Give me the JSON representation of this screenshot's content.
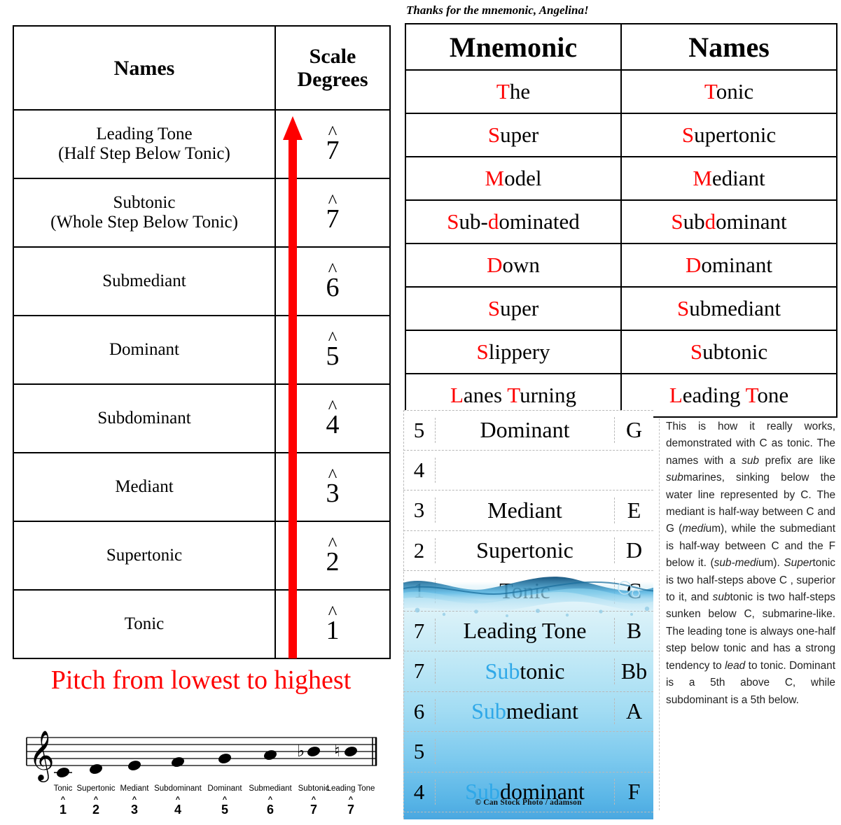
{
  "left_table": {
    "headers": {
      "names": "Names",
      "degrees": "Scale Degrees",
      "degrees_line1": "Scale",
      "degrees_line2": "Degrees"
    },
    "rows": [
      {
        "name": "Leading Tone",
        "qualifier": "(Half Step Below Tonic)",
        "degree": "7"
      },
      {
        "name": "Subtonic",
        "qualifier": "(Whole Step Below Tonic)",
        "degree": "7"
      },
      {
        "name": "Submediant",
        "qualifier": "",
        "degree": "6"
      },
      {
        "name": "Dominant",
        "qualifier": "",
        "degree": "5"
      },
      {
        "name": "Subdominant",
        "qualifier": "",
        "degree": "4"
      },
      {
        "name": "Mediant",
        "qualifier": "",
        "degree": "3"
      },
      {
        "name": "Supertonic",
        "qualifier": "",
        "degree": "2"
      },
      {
        "name": "Tonic",
        "qualifier": "",
        "degree": "1"
      }
    ],
    "arrow_color": "#fe0000",
    "caption": "Pitch from lowest to highest",
    "caption_color": "#fe0000"
  },
  "mnemonic": {
    "note": "Thanks for the mnemonic, Angelina!",
    "headers": {
      "mnemonic": "Mnemonic",
      "names": "Names"
    },
    "highlight_color": "#fe0000",
    "rows": [
      {
        "m_hl1": "T",
        "m_rest1": "he",
        "m_hl2": "",
        "m_rest2": "",
        "n_hl1": "T",
        "n_rest1": "onic",
        "n_hl2": "",
        "n_rest2": ""
      },
      {
        "m_hl1": "S",
        "m_rest1": "uper",
        "m_hl2": "",
        "m_rest2": "",
        "n_hl1": "S",
        "n_rest1": "upertonic",
        "n_hl2": "",
        "n_rest2": ""
      },
      {
        "m_hl1": "M",
        "m_rest1": "odel",
        "m_hl2": "",
        "m_rest2": "",
        "n_hl1": "M",
        "n_rest1": "ediant",
        "n_hl2": "",
        "n_rest2": ""
      },
      {
        "m_hl1": "S",
        "m_rest1": "ub-",
        "m_hl2": "d",
        "m_rest2": "ominated",
        "n_hl1": "S",
        "n_rest1": "ub",
        "n_hl2": "d",
        "n_rest2": "ominant"
      },
      {
        "m_hl1": "D",
        "m_rest1": "own",
        "m_hl2": "",
        "m_rest2": "",
        "n_hl1": "D",
        "n_rest1": "ominant",
        "n_hl2": "",
        "n_rest2": ""
      },
      {
        "m_hl1": "S",
        "m_rest1": "uper",
        "m_hl2": "",
        "m_rest2": "",
        "n_hl1": "S",
        "n_rest1": "ubmediant",
        "n_hl2": "",
        "n_rest2": ""
      },
      {
        "m_hl1": "S",
        "m_rest1": "lippery",
        "m_hl2": "",
        "m_rest2": "",
        "n_hl1": "S",
        "n_rest1": "ubtonic",
        "n_hl2": "",
        "n_rest2": ""
      },
      {
        "m_hl1": "L",
        "m_rest1": "anes ",
        "m_hl2": "T",
        "m_rest2": "urning",
        "n_hl1": "L",
        "n_rest1": "eading ",
        "n_hl2": "T",
        "n_rest2": "one"
      }
    ]
  },
  "water_panel": {
    "sub_highlight_color": "#2fa8e8",
    "watermark": "© Can Stock Photo /  adamson",
    "rows": [
      {
        "degree": "5",
        "sub": "",
        "name": "Dominant",
        "note": "G"
      },
      {
        "degree": "4",
        "sub": "",
        "name": "",
        "note": ""
      },
      {
        "degree": "3",
        "sub": "",
        "name": "Mediant",
        "note": "E"
      },
      {
        "degree": "2",
        "sub": "",
        "name": "Supertonic",
        "note": "D"
      },
      {
        "degree": "1",
        "sub": "",
        "name": "Tonic",
        "note": "C"
      },
      {
        "degree": "7",
        "sub": "",
        "name": "Leading Tone",
        "note": "B"
      },
      {
        "degree": "7",
        "sub": "Sub",
        "name": "tonic",
        "note": "Bb"
      },
      {
        "degree": "6",
        "sub": "Sub",
        "name": "mediant",
        "note": "A"
      },
      {
        "degree": "5",
        "sub": "",
        "name": "",
        "note": ""
      },
      {
        "degree": "4",
        "sub": "Sub",
        "name": "dominant",
        "note": "F"
      }
    ]
  },
  "explanation": {
    "p1": "This is how it really works, demonstrated with C as tonic. The  names with a ",
    "i1": "sub",
    "p2": " prefix are like ",
    "i2": "sub",
    "p3": "marines, sinking below the water line represented by C.  The mediant is half-way between C and G (",
    "i3": "medi",
    "p4": "um), while the submediant is half-way between C and the F below it. (",
    "i4": "sub-medi",
    "p5": "um). ",
    "i5": "Super",
    "p6": "tonic is two half-steps above C , superior to it, and ",
    "i6": "sub",
    "p7": "tonic is two half-steps sunken below C, submarine-like.  The leading tone is always one-half step below tonic and has a strong tendency to ",
    "i7": "lead",
    "p8": " to tonic. Dominant is a 5th above C, while subdominant is a 5th below."
  },
  "staff": {
    "notes": [
      {
        "label": "Tonic",
        "degree": "1",
        "accidental": ""
      },
      {
        "label": "Supertonic",
        "degree": "2",
        "accidental": ""
      },
      {
        "label": "Mediant",
        "degree": "3",
        "accidental": ""
      },
      {
        "label": "Subdominant",
        "degree": "4",
        "accidental": ""
      },
      {
        "label": "Dominant",
        "degree": "5",
        "accidental": ""
      },
      {
        "label": "Submediant",
        "degree": "6",
        "accidental": ""
      },
      {
        "label": "Subtonic",
        "degree": "7",
        "accidental": "♭"
      },
      {
        "label": "Leading Tone",
        "degree": "7",
        "accidental": "♮"
      }
    ],
    "clef": "treble"
  }
}
